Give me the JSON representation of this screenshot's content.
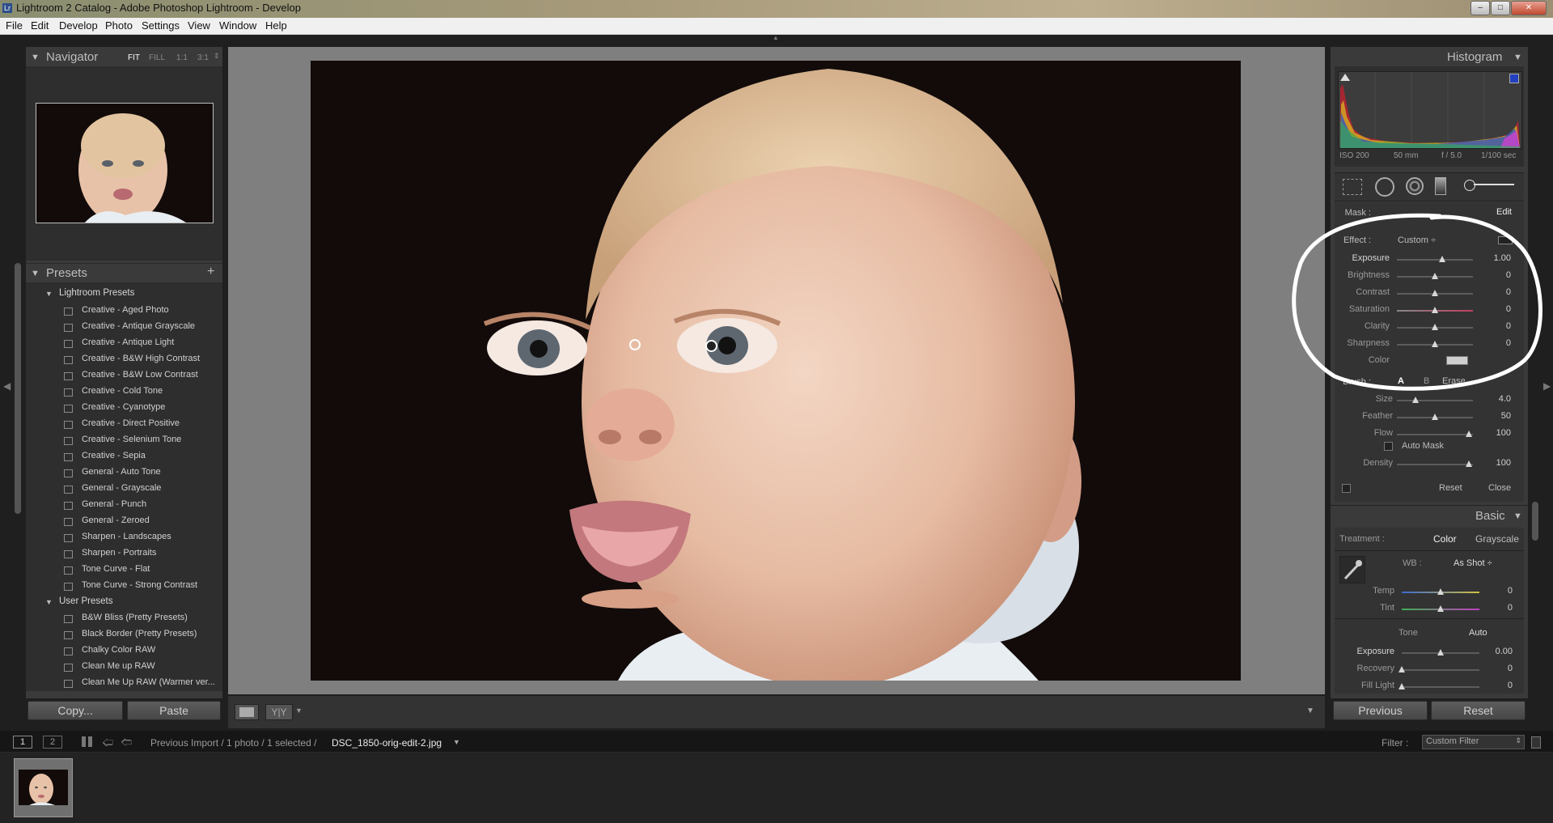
{
  "window": {
    "title": "Lightroom 2 Catalog - Adobe Photoshop Lightroom - Develop"
  },
  "menu": [
    "File",
    "Edit",
    "Develop",
    "Photo",
    "Settings",
    "View",
    "Window",
    "Help"
  ],
  "navigator": {
    "title": "Navigator",
    "zoom": [
      "FIT",
      "FILL",
      "1:1",
      "3:1"
    ]
  },
  "presets": {
    "title": "Presets",
    "lightroom_folder": "Lightroom Presets",
    "lightroom_items": [
      "Creative - Aged Photo",
      "Creative - Antique Grayscale",
      "Creative - Antique Light",
      "Creative - B&W High Contrast",
      "Creative - B&W Low Contrast",
      "Creative - Cold Tone",
      "Creative - Cyanotype",
      "Creative - Direct Positive",
      "Creative - Selenium Tone",
      "Creative - Sepia",
      "General - Auto Tone",
      "General - Grayscale",
      "General - Punch",
      "General - Zeroed",
      "Sharpen - Landscapes",
      "Sharpen - Portraits",
      "Tone Curve - Flat",
      "Tone Curve - Strong Contrast"
    ],
    "user_folder": "User Presets",
    "user_items": [
      "B&W Bliss (Pretty Presets)",
      "Black Border (Pretty Presets)",
      "Chalky Color RAW",
      "Clean Me up RAW",
      "Clean Me Up RAW (Warmer ver..."
    ]
  },
  "left_buttons": {
    "copy": "Copy...",
    "paste": "Paste"
  },
  "histogram": {
    "title": "Histogram",
    "iso": "ISO 200",
    "focal": "50 mm",
    "aperture": "f / 5.0",
    "shutter": "1/100 sec"
  },
  "mask": {
    "label": "Mask :",
    "edit": "Edit",
    "effect_label": "Effect :",
    "effect_value": "Custom ÷"
  },
  "brush_sliders": [
    {
      "name": "Exposure",
      "value": "1.00",
      "pos": 0.6
    },
    {
      "name": "Brightness",
      "value": "0",
      "pos": 0.5
    },
    {
      "name": "Contrast",
      "value": "0",
      "pos": 0.5
    },
    {
      "name": "Saturation",
      "value": "0",
      "pos": 0.5
    },
    {
      "name": "Clarity",
      "value": "0",
      "pos": 0.5
    },
    {
      "name": "Sharpness",
      "value": "0",
      "pos": 0.5
    }
  ],
  "color_label": "Color",
  "brush": {
    "label": "Brush :",
    "a": "A",
    "b": "B",
    "erase": "Erase"
  },
  "brush_settings": [
    {
      "name": "Size",
      "value": "4.0",
      "pos": 0.24
    },
    {
      "name": "Feather",
      "value": "50",
      "pos": 0.5
    },
    {
      "name": "Flow",
      "value": "100",
      "pos": 0.95
    }
  ],
  "automask": "Auto Mask",
  "density": {
    "name": "Density",
    "value": "100",
    "pos": 0.95
  },
  "brush_footer": {
    "reset": "Reset",
    "close": "Close"
  },
  "basic": {
    "title": "Basic",
    "treatment_label": "Treatment :",
    "color": "Color",
    "grayscale": "Grayscale",
    "wb_label": "WB :",
    "wb_value": "As Shot ÷",
    "temp": {
      "name": "Temp",
      "value": "0",
      "pos": 0.5
    },
    "tint": {
      "name": "Tint",
      "value": "0",
      "pos": 0.5
    },
    "tone": "Tone",
    "auto": "Auto",
    "exposure": {
      "name": "Exposure",
      "value": "0.00",
      "pos": 0.5
    },
    "recovery": {
      "name": "Recovery",
      "value": "0",
      "pos": 0.0
    },
    "filllight": {
      "name": "Fill Light",
      "value": "0",
      "pos": 0.0
    }
  },
  "right_buttons": {
    "previous": "Previous",
    "reset": "Reset"
  },
  "filmstrip": {
    "page1": "1",
    "page2": "2",
    "path": "Previous Import / 1 photo / 1 selected /",
    "filename": "DSC_1850-orig-edit-2.jpg",
    "filter_label": "Filter :",
    "filter_value": "Custom Filter"
  },
  "colors": {
    "accent": "#ffffff",
    "panel": "#3a3a3a",
    "background": "#1f1f1f"
  }
}
